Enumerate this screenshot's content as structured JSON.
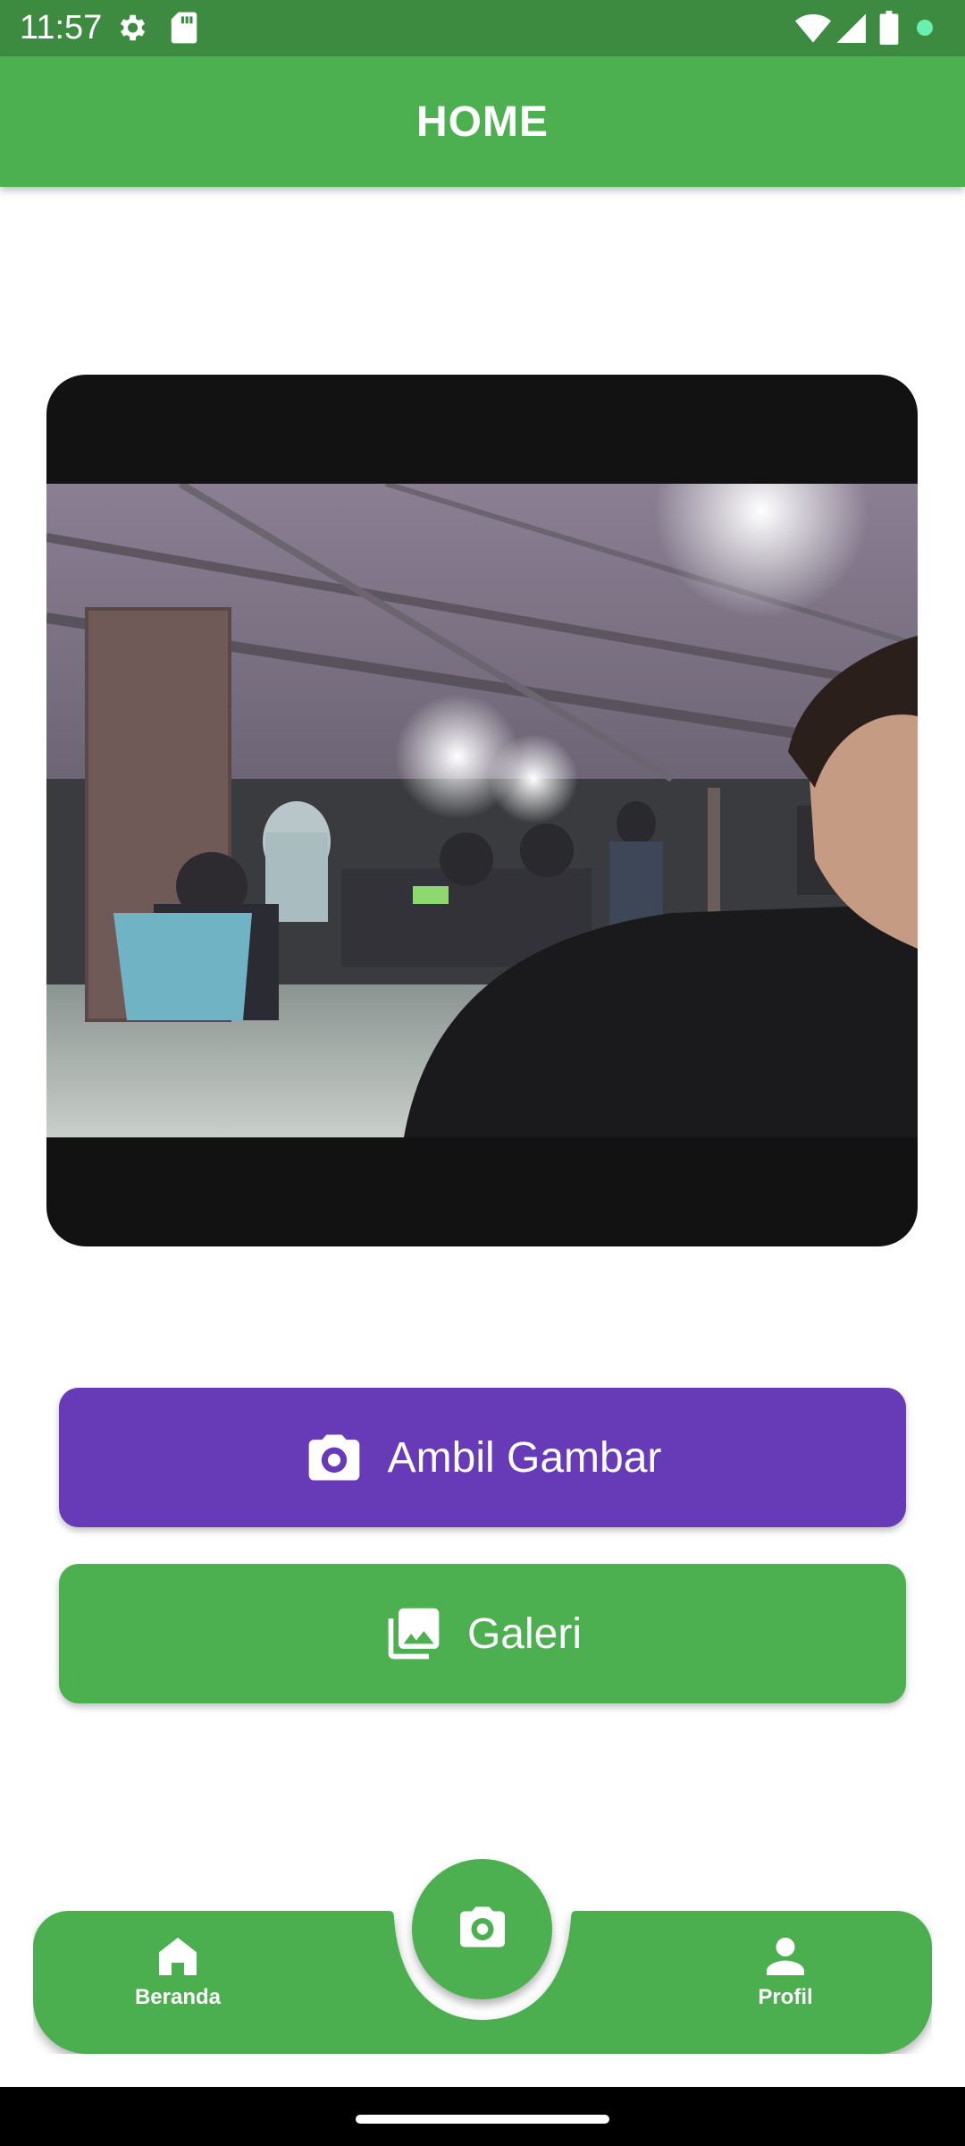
{
  "status_bar": {
    "time": "11:57",
    "icons": [
      "settings-gear-icon",
      "sd-card-icon",
      "wifi-icon",
      "cell-signal-icon",
      "battery-icon",
      "notification-dot-icon"
    ]
  },
  "app_bar": {
    "title": "HOME"
  },
  "preview": {
    "description_icon": "camera-preview-image"
  },
  "actions": {
    "camera_button_label": "Ambil Gambar",
    "camera_button_icon": "camera-icon",
    "gallery_button_label": "Galeri",
    "gallery_button_icon": "photo-library-icon"
  },
  "bottom_nav": {
    "home_label": "Beranda",
    "home_icon": "home-icon",
    "profile_label": "Profil",
    "profile_icon": "person-icon",
    "fab_icon": "camera-icon"
  },
  "colors": {
    "status_bar": "#3d8b40",
    "primary_green": "#4caf50",
    "accent_purple": "#673ab7",
    "preview_bg": "#121212"
  }
}
